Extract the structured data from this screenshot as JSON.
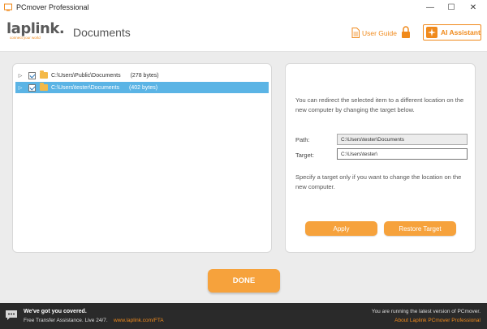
{
  "window": {
    "title": "PCmover Professional",
    "minimize_glyph": "—",
    "maximize_glyph": "☐",
    "close_glyph": "✕"
  },
  "header": {
    "logo_text": "laplink.",
    "logo_tagline": "connect your world",
    "page_title": "Documents",
    "user_guide_label": "User Guide",
    "ai_assistant_label": "AI Assistant",
    "accent_color": "#f08a1c"
  },
  "tree": {
    "items": [
      {
        "checked": true,
        "path": "C:\\Users\\Public\\Documents",
        "size": "(278 bytes)",
        "selected": false
      },
      {
        "checked": true,
        "path": "C:\\Users\\tester\\Documents",
        "size": "(402 bytes)",
        "selected": true
      }
    ],
    "selection_color": "#5bb4e5"
  },
  "details": {
    "description": "You can redirect the selected item to a different location on the new computer by changing the target below.",
    "path_label": "Path:",
    "path_value": "C:\\Users\\tester\\Documents",
    "target_label": "Target:",
    "target_value": "C:\\Users\\tester\\",
    "hint": "Specify a target only if you want to change the location on the new computer.",
    "apply_label": "Apply",
    "restore_label": "Restore Target"
  },
  "done_label": "DONE",
  "footer": {
    "title": "We've got you covered.",
    "subtitle": "Free Transfer Assistance. Live 24/7.",
    "link": "www.laplink.com/FTA",
    "status": "You are running the latest version of PCmover.",
    "about": "About Laplink PCmover Professional"
  }
}
